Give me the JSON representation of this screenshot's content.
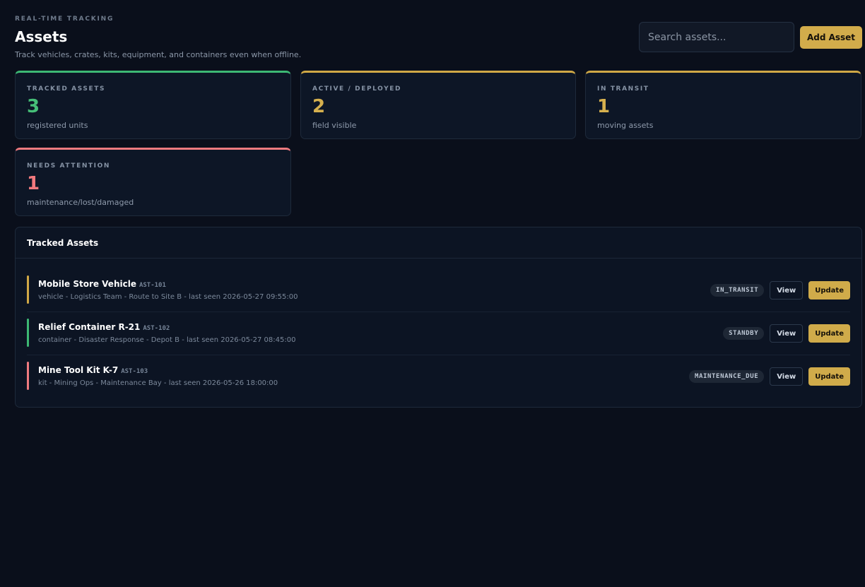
{
  "header": {
    "eyebrow": "REAL-TIME TRACKING",
    "title": "Assets",
    "subtitle": "Track vehicles, crates, kits, equipment, and containers even when offline.",
    "search_placeholder": "Search assets...",
    "add_label": "Add Asset"
  },
  "stats": [
    {
      "label": "TRACKED ASSETS",
      "value": "3",
      "caption": "registered units",
      "accent": "#3db874"
    },
    {
      "label": "ACTIVE / DEPLOYED",
      "value": "2",
      "caption": "field visible",
      "accent": "#cfa846"
    },
    {
      "label": "IN TRANSIT",
      "value": "1",
      "caption": "moving assets",
      "accent": "#cfa846"
    },
    {
      "label": "NEEDS ATTENTION",
      "value": "1",
      "caption": "maintenance/lost/damaged",
      "accent": "#ef7a7f"
    }
  ],
  "panel": {
    "title": "Tracked Assets",
    "view_label": "View",
    "update_label": "Update"
  },
  "assets": [
    {
      "name": "Mobile Store Vehicle",
      "code": "AST-101",
      "meta": "vehicle - Logistics Team - Route to Site B - last seen 2026-05-27 09:55:00",
      "status": "IN_TRANSIT",
      "accent": "#d0a846"
    },
    {
      "name": "Relief Container R-21",
      "code": "AST-102",
      "meta": "container - Disaster Response - Depot B - last seen 2026-05-27 08:45:00",
      "status": "STANDBY",
      "accent": "#3db874"
    },
    {
      "name": "Mine Tool Kit K-7",
      "code": "AST-103",
      "meta": "kit - Mining Ops - Maintenance Bay - last seen 2026-05-26 18:00:00",
      "status": "MAINTENANCE_DUE",
      "accent": "#ef7a7f"
    }
  ]
}
